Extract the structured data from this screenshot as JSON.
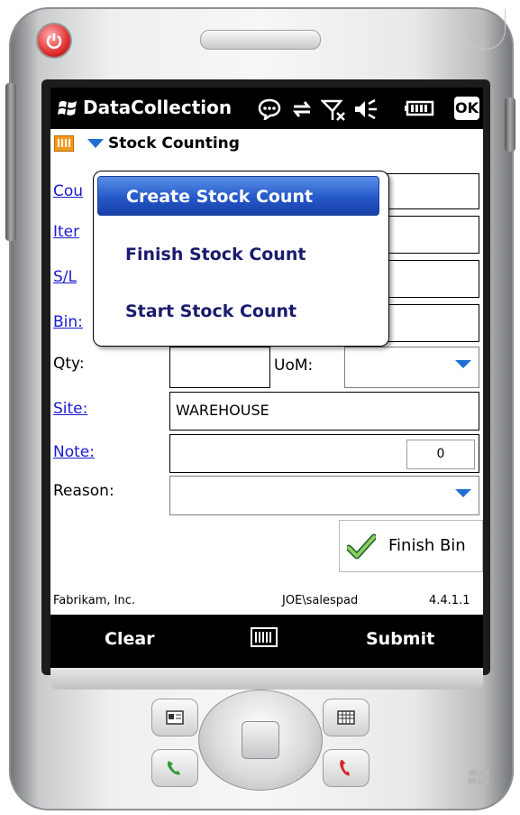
{
  "device": {
    "power_icon": "power-icon",
    "brand_icon": "windows-flag-icon"
  },
  "titlebar": {
    "title": "DataCollection",
    "icons": [
      "windows-flag-icon",
      "notification-icon",
      "sync-icon",
      "signal-off-icon",
      "speaker-muted-icon",
      "battery-icon",
      "ok-icon"
    ],
    "ok_label": "OK"
  },
  "appbar": {
    "label": "Stock Counting",
    "icon": "keyboard-icon",
    "dropdown_icon": "triangle-down-icon"
  },
  "form": {
    "count_label": "Cou",
    "item_label": "Iter",
    "sl_label": "S/L",
    "bin_label": "Bin:",
    "qty_label": "Qty:",
    "qty_value": "",
    "uom_label": "UoM:",
    "uom_value": "",
    "site_label": "Site:",
    "site_value": "WAREHOUSE",
    "note_label": "Note:",
    "note_count": "0",
    "reason_label": "Reason:",
    "reason_value": "",
    "finish_bin_label": "Finish Bin"
  },
  "menu": {
    "items": [
      {
        "label": "Create Stock Count",
        "selected": true
      },
      {
        "label": "Finish Stock Count",
        "selected": false
      },
      {
        "label": "Start Stock Count",
        "selected": false
      }
    ]
  },
  "status": {
    "company": "Fabrikam, Inc.",
    "user": "JOE\\salespad",
    "version": "4.4.1.1"
  },
  "softkeys": {
    "left": "Clear",
    "right": "Submit",
    "center_icon": "keyboard-icon"
  },
  "colors": {
    "link": "#1a1acc",
    "menu_highlight": "#2458c8",
    "menu_text": "#1b1b6e",
    "caret": "#1e6fd1"
  }
}
